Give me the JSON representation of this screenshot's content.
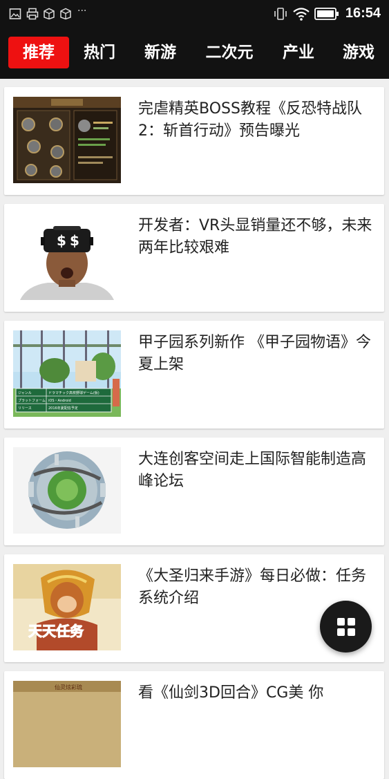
{
  "status_bar": {
    "time": "16:54",
    "left_icons": [
      "image-icon",
      "print-icon",
      "package-icon",
      "package-icon"
    ],
    "more_glyph": "···",
    "right_icons": [
      "vibrate-icon",
      "wifi-icon",
      "battery-icon"
    ]
  },
  "tabs": [
    {
      "label": "推荐",
      "active": true
    },
    {
      "label": "热门",
      "active": false
    },
    {
      "label": "新游",
      "active": false
    },
    {
      "label": "二次元",
      "active": false
    },
    {
      "label": "产业",
      "active": false
    },
    {
      "label": "游戏",
      "active": false
    }
  ],
  "articles": [
    {
      "title": "完虐精英BOSS教程《反恐特战队2：斩首行动》预告曝光",
      "thumb": "game-menu-screenshot"
    },
    {
      "title": "开发者：VR头显销量还不够，未来两年比较艰难",
      "thumb": "vr-headset-man"
    },
    {
      "title": "甲子园系列新作 《甲子园物语》今夏上架",
      "thumb": "baseball-field",
      "thumb_text": [
        "ジャンル",
        "ドラマチック高校野球ゲーム(仮)",
        "プラットフォーム",
        "iOS・Android",
        "リリース",
        "2016年夏配信予定"
      ]
    },
    {
      "title": "大连创客空间走上国际智能制造高峰论坛",
      "thumb": "city-globe"
    },
    {
      "title": "《大圣归来手游》每日必做：任务系统介绍",
      "thumb": "monkey-king",
      "thumb_text": [
        "天天任务"
      ]
    },
    {
      "title": "看《仙剑3D回合》CG美 你",
      "thumb": "xianjian-game",
      "thumb_text": [
        "仙灵炫彩琉"
      ]
    }
  ],
  "fab": {
    "icon": "grid-icon"
  },
  "colors": {
    "bar_bg": "#121212",
    "active_tab": "#ee1111",
    "card_bg": "#ffffff",
    "page_bg": "#efefef",
    "title_text": "#222222"
  }
}
